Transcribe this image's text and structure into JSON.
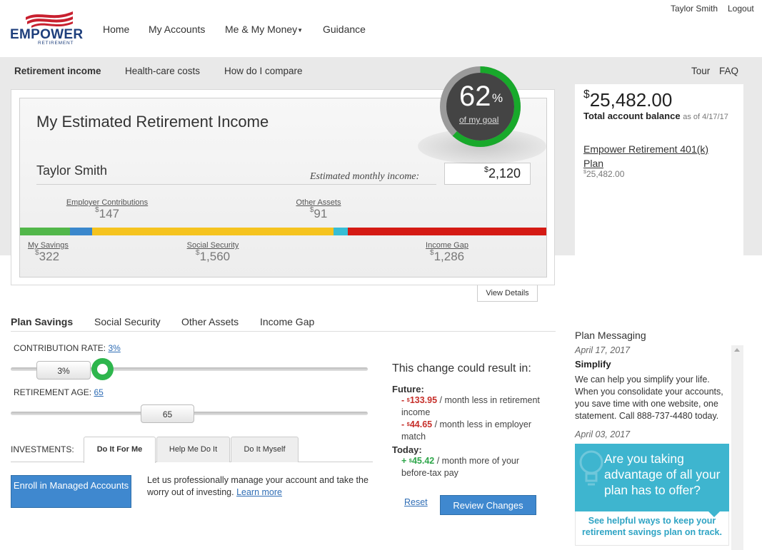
{
  "header": {
    "logo_text": "EMPOWER",
    "logo_sub": "RETIREMENT",
    "nav": [
      "Home",
      "My Accounts",
      "Me & My Money",
      "Guidance"
    ],
    "user_name": "Taylor Smith",
    "logout": "Logout"
  },
  "subnav": {
    "items": [
      "Retirement income",
      "Health-care costs",
      "How do I compare"
    ],
    "tour": "Tour",
    "faq": "FAQ"
  },
  "income_card": {
    "title": "My Estimated Retirement Income",
    "name": "Taylor Smith",
    "estimated_label": "Estimated monthly income:",
    "estimated_value": "2,120",
    "goal_percent": 62,
    "goal_percent_label": "62",
    "goal_percent_sign": "%",
    "goal_label": "of my goal",
    "view_details": "View Details",
    "segments": [
      {
        "label": "My Savings",
        "value": "322",
        "amount": 322,
        "color": "#52b74a"
      },
      {
        "label": "Employer Contributions",
        "value": "147",
        "amount": 147,
        "color": "#3a87cc"
      },
      {
        "label": "Social Security",
        "value": "1,560",
        "amount": 1560,
        "color": "#f5c31f"
      },
      {
        "label": "Other Assets",
        "value": "91",
        "amount": 91,
        "color": "#37bdd4"
      },
      {
        "label": "Income Gap",
        "value": "1,286",
        "amount": 1286,
        "color": "#d41a14"
      }
    ],
    "currency": "$"
  },
  "balance": {
    "amount": "25,482.00",
    "label": "Total account balance",
    "as_of": "as of 4/17/17",
    "plan_name": "Empower Retirement 401(k) Plan",
    "plan_balance": "25,482.00"
  },
  "plan_tabs": [
    "Plan Savings",
    "Social Security",
    "Other Assets",
    "Income Gap"
  ],
  "contribution": {
    "label": "CONTRIBUTION RATE:",
    "value": "3%",
    "slider_value": "3%"
  },
  "retirement_age": {
    "label": "RETIREMENT AGE:",
    "value": "65",
    "slider_value": "65"
  },
  "investments": {
    "label": "INVESTMENTS:",
    "tabs": [
      "Do It For Me",
      "Help Me Do It",
      "Do It Myself"
    ],
    "enroll_button": "Enroll in Managed Accounts",
    "description": "Let us professionally manage your account and take the worry out of investing.",
    "learn_more": "Learn more"
  },
  "result": {
    "title": "This change could result in:",
    "future_label": "Future:",
    "future_1_amount": "- $133.95",
    "future_1_amount_sign": "- ",
    "future_1_amount_cur": "$",
    "future_1_amount_num": "133.95",
    "future_1_text": "/ month less in retirement income",
    "future_2_amount_sign": "- ",
    "future_2_amount_cur": "$",
    "future_2_amount_num": "44.65",
    "future_2_text": "/ month less in employer match",
    "today_label": "Today:",
    "today_amount_sign": "+ ",
    "today_amount_cur": "$",
    "today_amount_num": "45.42",
    "today_text": "/ month more of your before-tax pay",
    "reset": "Reset",
    "review": "Review Changes"
  },
  "messaging": {
    "title": "Plan Messaging",
    "date_1": "April 17, 2017",
    "heading_1": "Simplify",
    "body_1": "We can help you simplify your life. When you consolidate your accounts, you save time with one website, one statement. Call 888-737-4480 today.",
    "date_2": "April 03, 2017",
    "promo_text": "Are you taking advantage of all your plan has to offer?",
    "promo_sub": "See helpful ways to keep your retirement savings plan on track."
  }
}
